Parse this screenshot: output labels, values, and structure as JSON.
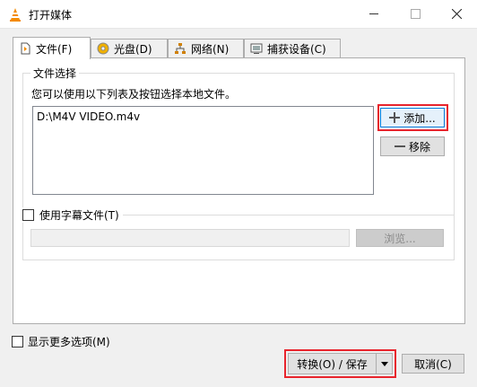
{
  "window": {
    "title": "打开媒体"
  },
  "tabs": [
    {
      "label": "文件(F)",
      "icon": "file-icon"
    },
    {
      "label": "光盘(D)",
      "icon": "disc-icon"
    },
    {
      "label": "网络(N)",
      "icon": "network-icon"
    },
    {
      "label": "捕获设备(C)",
      "icon": "capture-icon"
    }
  ],
  "file_selection": {
    "legend": "文件选择",
    "hint": "您可以使用以下列表及按钮选择本地文件。",
    "files": [
      "D:\\M4V VIDEO.m4v"
    ],
    "add_label": "添加...",
    "remove_label": "移除"
  },
  "subtitle": {
    "label": "使用字幕文件(T)",
    "checked": false,
    "browse_label": "浏览..."
  },
  "footer": {
    "more_options_label": "显示更多选项(M)",
    "convert_label": "转换(O) / 保存",
    "cancel_label": "取消(C)"
  },
  "colors": {
    "highlight": "#e8242c",
    "accent": "#0078d7"
  }
}
